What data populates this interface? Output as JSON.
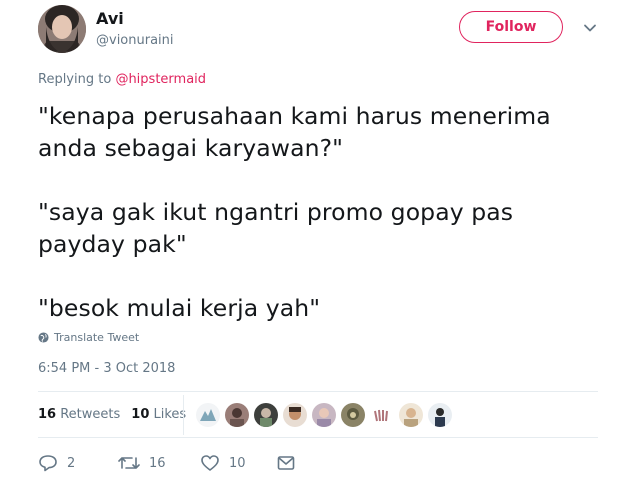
{
  "user": {
    "name": "Avi",
    "handle": "@vionuraini"
  },
  "follow_label": "Follow",
  "reply_prefix": "Replying to",
  "reply_to": "@hipstermaid",
  "tweet_lines": [
    "\"kenapa perusahaan kami harus menerima",
    "anda sebagai karyawan?\"",
    "\"saya gak ikut ngantri promo gopay pas",
    "payday pak\"",
    "\"besok mulai kerja yah\""
  ],
  "translate_label": "Translate Tweet",
  "timestamp": "6:54 PM - 3 Oct 2018",
  "stats": {
    "retweets_count": "16",
    "retweets_label": "Retweets",
    "likes_count": "10",
    "likes_label": "Likes"
  },
  "liker_avatar_count": 9,
  "actions": {
    "replies": "2",
    "retweets": "16",
    "likes": "10"
  },
  "colors": {
    "accent": "#e0245e",
    "muted": "#657786",
    "text": "#14171a",
    "divider": "#e6ecf0"
  },
  "icons": [
    "chevron-down-icon",
    "globe-icon",
    "reply-icon",
    "retweet-icon",
    "heart-icon",
    "mail-icon"
  ]
}
